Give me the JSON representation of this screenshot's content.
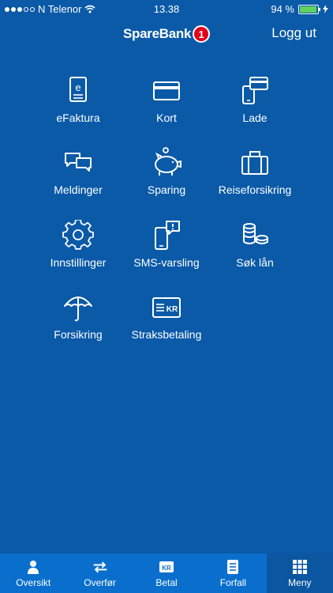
{
  "status_bar": {
    "carrier": "N Telenor",
    "time": "13.38",
    "battery_percent": "94 %",
    "battery_level": 0.94,
    "signal_bars": 3,
    "signal_total": 5
  },
  "header": {
    "brand": "SpareBank",
    "brand_badge": "1",
    "logout_label": "Logg ut",
    "brand_red": "#e2001a"
  },
  "menu": {
    "items": [
      {
        "label": "eFaktura",
        "icon": "efaktura-icon"
      },
      {
        "label": "Kort",
        "icon": "card-icon"
      },
      {
        "label": "Lade",
        "icon": "lade-icon"
      },
      {
        "label": "Meldinger",
        "icon": "messages-icon"
      },
      {
        "label": "Sparing",
        "icon": "piggy-bank-icon"
      },
      {
        "label": "Reiseforsikring",
        "icon": "suitcase-icon"
      },
      {
        "label": "Innstillinger",
        "icon": "gear-icon"
      },
      {
        "label": "SMS-varsling",
        "icon": "sms-alert-icon"
      },
      {
        "label": "Søk lån",
        "icon": "coins-icon"
      },
      {
        "label": "Forsikring",
        "icon": "umbrella-icon"
      },
      {
        "label": "Straksbetaling",
        "icon": "instant-payment-icon"
      }
    ]
  },
  "tabbar": {
    "tabs": [
      {
        "label": "Oversikt",
        "icon": "person-icon"
      },
      {
        "label": "Overfør",
        "icon": "transfer-icon"
      },
      {
        "label": "Betal",
        "icon": "kr-icon",
        "icon_text": "KR"
      },
      {
        "label": "Forfall",
        "icon": "document-icon"
      },
      {
        "label": "Meny",
        "icon": "grid-icon",
        "active": true
      }
    ]
  },
  "colors": {
    "background": "#0a5aa8",
    "tabbar": "#0a6fcc",
    "tab_active": "#0a56a0",
    "battery_green": "#5fd35f"
  },
  "icon_glyphs": {
    "straksbetaling_badge": "KR"
  }
}
